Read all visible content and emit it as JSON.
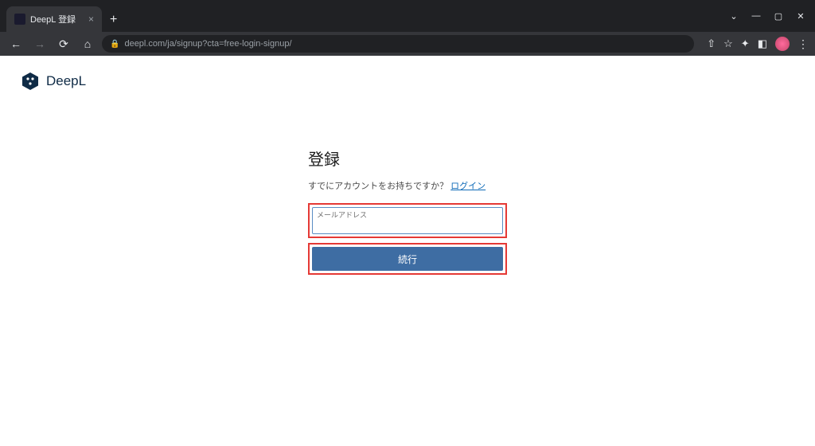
{
  "browser": {
    "tab": {
      "title": "DeepL 登録"
    },
    "url": "deepl.com/ja/signup?cta=free-login-signup/",
    "controls": {
      "minimize": "—",
      "maximize": "▢",
      "close": "✕",
      "chevdown": "⌄"
    }
  },
  "header": {
    "brand": "DeepL"
  },
  "signup": {
    "title": "登録",
    "subtitle_prefix": "すでにアカウントをお持ちですか？ ",
    "login_link": "ログイン",
    "email_label": "メールアドレス",
    "email_value": "",
    "submit_label": "続行"
  }
}
